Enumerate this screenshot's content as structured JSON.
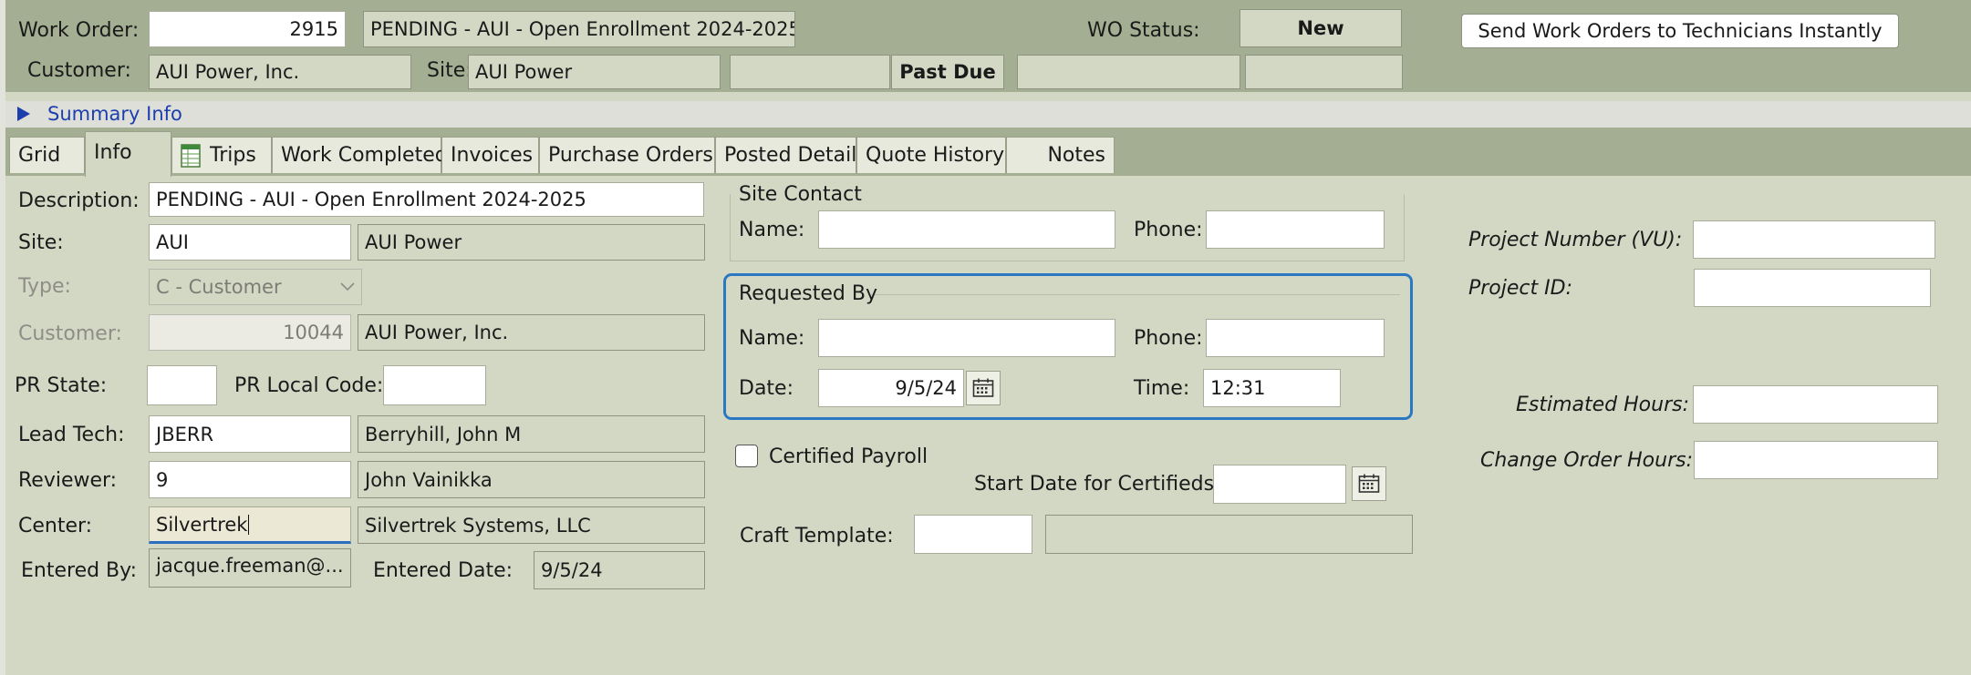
{
  "header": {
    "work_order_label": "Work Order:",
    "work_order_number": "2915",
    "work_order_title": "PENDING -  AUI - Open Enrollment 2024-2025",
    "wo_status_label": "WO Status:",
    "wo_status_value": "New",
    "send_button": "Send Work Orders to Technicians Instantly",
    "customer_label": "Customer:",
    "customer_value": "AUI Power, Inc.",
    "site_label": "Site:",
    "site_value": "AUI Power",
    "past_due": "Past Due"
  },
  "summary": {
    "label": "Summary Info",
    "icon": "expand-triangle-icon"
  },
  "tabs": [
    {
      "label": "Grid"
    },
    {
      "label": "Info"
    },
    {
      "label": "Trips",
      "icon": "spreadsheet-icon"
    },
    {
      "label": "Work Completed"
    },
    {
      "label": "Invoices"
    },
    {
      "label": "Purchase Orders"
    },
    {
      "label": "Posted Detail"
    },
    {
      "label": "Quote History"
    },
    {
      "label": "Notes"
    }
  ],
  "info": {
    "description_label": "Description:",
    "description_value": "PENDING -  AUI - Open Enrollment 2024-2025",
    "site_label": "Site:",
    "site_code": "AUI",
    "site_name": "AUI Power",
    "type_label": "Type:",
    "type_value": "C - Customer",
    "customer_label": "Customer:",
    "customer_number": "10044",
    "customer_name": "AUI Power, Inc.",
    "pr_state_label": "PR State:",
    "pr_state_value": "",
    "pr_local_code_label": "PR Local Code:",
    "pr_local_code_value": "",
    "lead_tech_label": "Lead Tech:",
    "lead_tech_code": "JBERR",
    "lead_tech_name": "Berryhill, John M",
    "reviewer_label": "Reviewer:",
    "reviewer_code": "9",
    "reviewer_name": "John Vainikka",
    "center_label": "Center:",
    "center_code": "Silvertrek",
    "center_name": "Silvertrek Systems, LLC",
    "entered_by_label": "Entered By:",
    "entered_by_value": "jacque.freeman@...",
    "entered_date_label": "Entered Date:",
    "entered_date_value": "9/5/24"
  },
  "site_contact": {
    "title": "Site Contact",
    "name_label": "Name:",
    "name_value": "",
    "phone_label": "Phone:",
    "phone_value": ""
  },
  "requested_by": {
    "title": "Requested By",
    "name_label": "Name:",
    "name_value": "",
    "phone_label": "Phone:",
    "phone_value": "",
    "date_label": "Date:",
    "date_value": "9/5/24",
    "time_label": "Time:",
    "time_value": "12:31"
  },
  "certified": {
    "certified_payroll_label": "Certified Payroll",
    "start_date_label": "Start Date for Certifieds:",
    "start_date_value": "",
    "craft_template_label": "Craft Template:",
    "craft_template_code": "",
    "craft_template_name": ""
  },
  "project": {
    "project_number_label": "Project Number (VU):",
    "project_number_value": "",
    "project_id_label": "Project ID:",
    "project_id_value": "",
    "estimated_hours_label": "Estimated Hours:",
    "estimated_hours_value": "",
    "change_order_hours_label": "Change Order Hours:",
    "change_order_hours_value": ""
  }
}
